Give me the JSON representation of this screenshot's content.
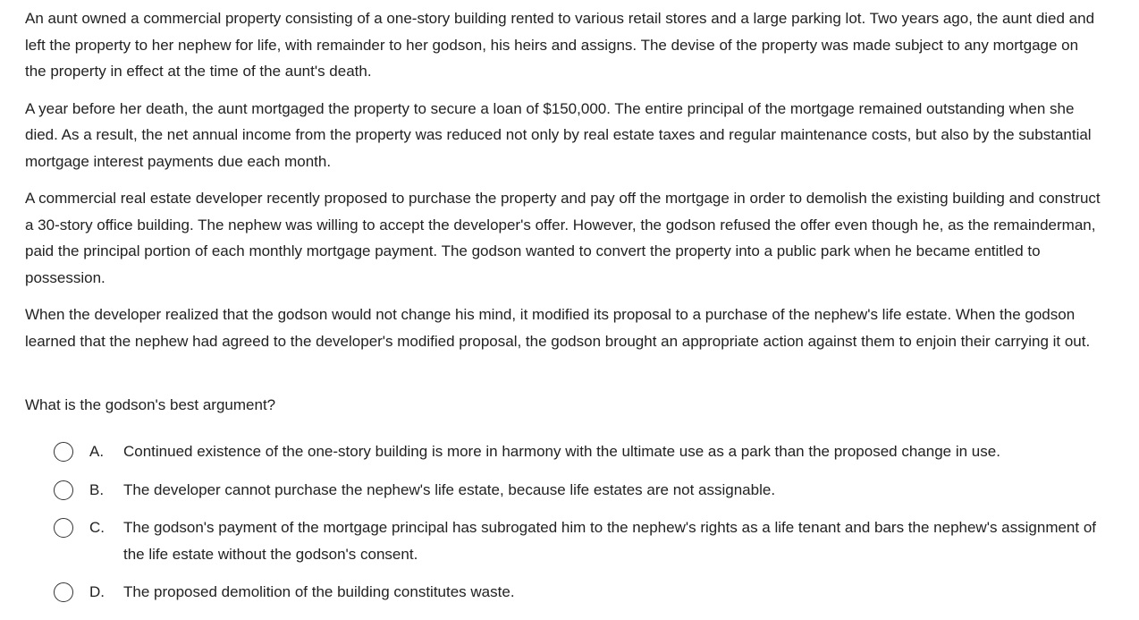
{
  "question": {
    "paragraphs": [
      "An aunt owned a commercial property consisting of a one-story building rented to various retail stores and a large parking lot.  Two years ago, the aunt died and left the property to her nephew for life, with remainder to her godson, his heirs and assigns.  The devise of the property was made subject to any mortgage on the property in effect at the time of the aunt's death.",
      "A year before her death, the aunt mortgaged the property to secure a loan of $150,000.  The entire principal of the mortgage remained outstanding when she died.  As a result, the net annual income from the property was reduced not only by real estate taxes and regular maintenance costs, but also by the substantial mortgage interest payments due each month.",
      "A commercial real estate developer recently proposed to purchase the property and pay off the mortgage in order to demolish the existing building and construct a 30-story office building.  The nephew was willing to accept the developer's offer.  However, the godson refused the offer even though he, as the remainderman, paid the principal portion of each monthly mortgage payment.  The godson wanted to convert the property into a public park when he became entitled to possession.",
      "When the developer realized that the godson would not change his mind, it modified its proposal to a purchase of the nephew's life estate.  When the godson learned that the nephew had agreed to the developer's modified proposal, the godson brought an appropriate action against them to enjoin their carrying it out."
    ],
    "stem": "What is the godson's best argument?"
  },
  "options": [
    {
      "letter": "A.",
      "text": "Continued existence of the one-story building is more in harmony with the ultimate use as a park than the proposed change in use."
    },
    {
      "letter": "B.",
      "text": "The developer cannot purchase the nephew's life estate, because life estates are not assignable."
    },
    {
      "letter": "C.",
      "text": "The godson's payment of the mortgage principal has subrogated him to the nephew's rights as a life tenant and bars the nephew's assignment of the life estate without the godson's consent."
    },
    {
      "letter": "D.",
      "text": "The proposed demolition of the building constitutes waste."
    }
  ]
}
